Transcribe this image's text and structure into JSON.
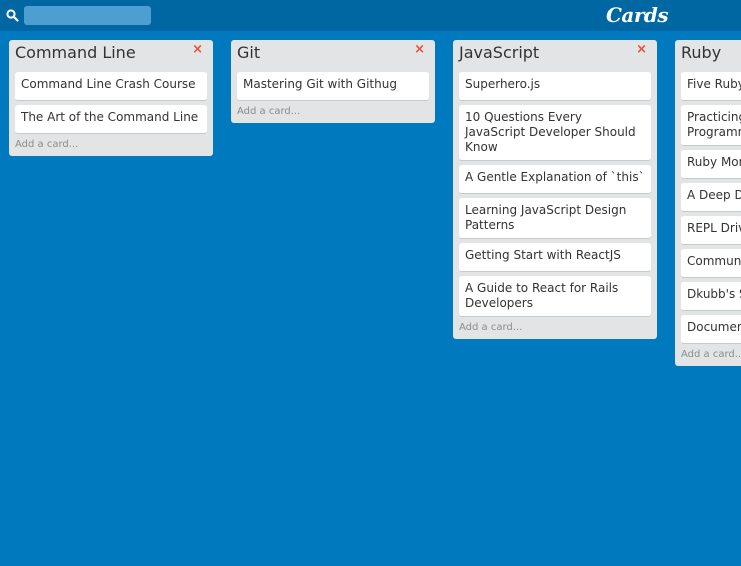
{
  "header": {
    "search_placeholder": "",
    "search_value": "",
    "logo_text": "Cards"
  },
  "lists": [
    {
      "title": "Command Line",
      "delete_label": "×",
      "cards": [
        "Command Line Crash Course",
        "The Art of the Command Line"
      ],
      "add_label": "Add a card..."
    },
    {
      "title": "Git",
      "delete_label": "×",
      "cards": [
        "Mastering Git with Githug"
      ],
      "add_label": "Add a card..."
    },
    {
      "title": "JavaScript",
      "delete_label": "×",
      "cards": [
        "Superhero.js",
        "10 Questions Every JavaScript Developer Should Know",
        "A Gentle Explanation of `this`",
        "Learning JavaScript Design Patterns",
        "Getting Start with ReactJS",
        "A Guide to React for Rails Developers"
      ],
      "add_label": "Add a card..."
    },
    {
      "title": "Ruby",
      "delete_label": "×",
      "cards": [
        "Five Ruby Be Using",
        "Practicing Lessons f Programm",
        "Ruby Mon Programm",
        "A Deep D",
        "REPL Driv Pry",
        "Commun",
        "Dkubb's S",
        "Documen"
      ],
      "add_label": "Add a card..."
    }
  ]
}
